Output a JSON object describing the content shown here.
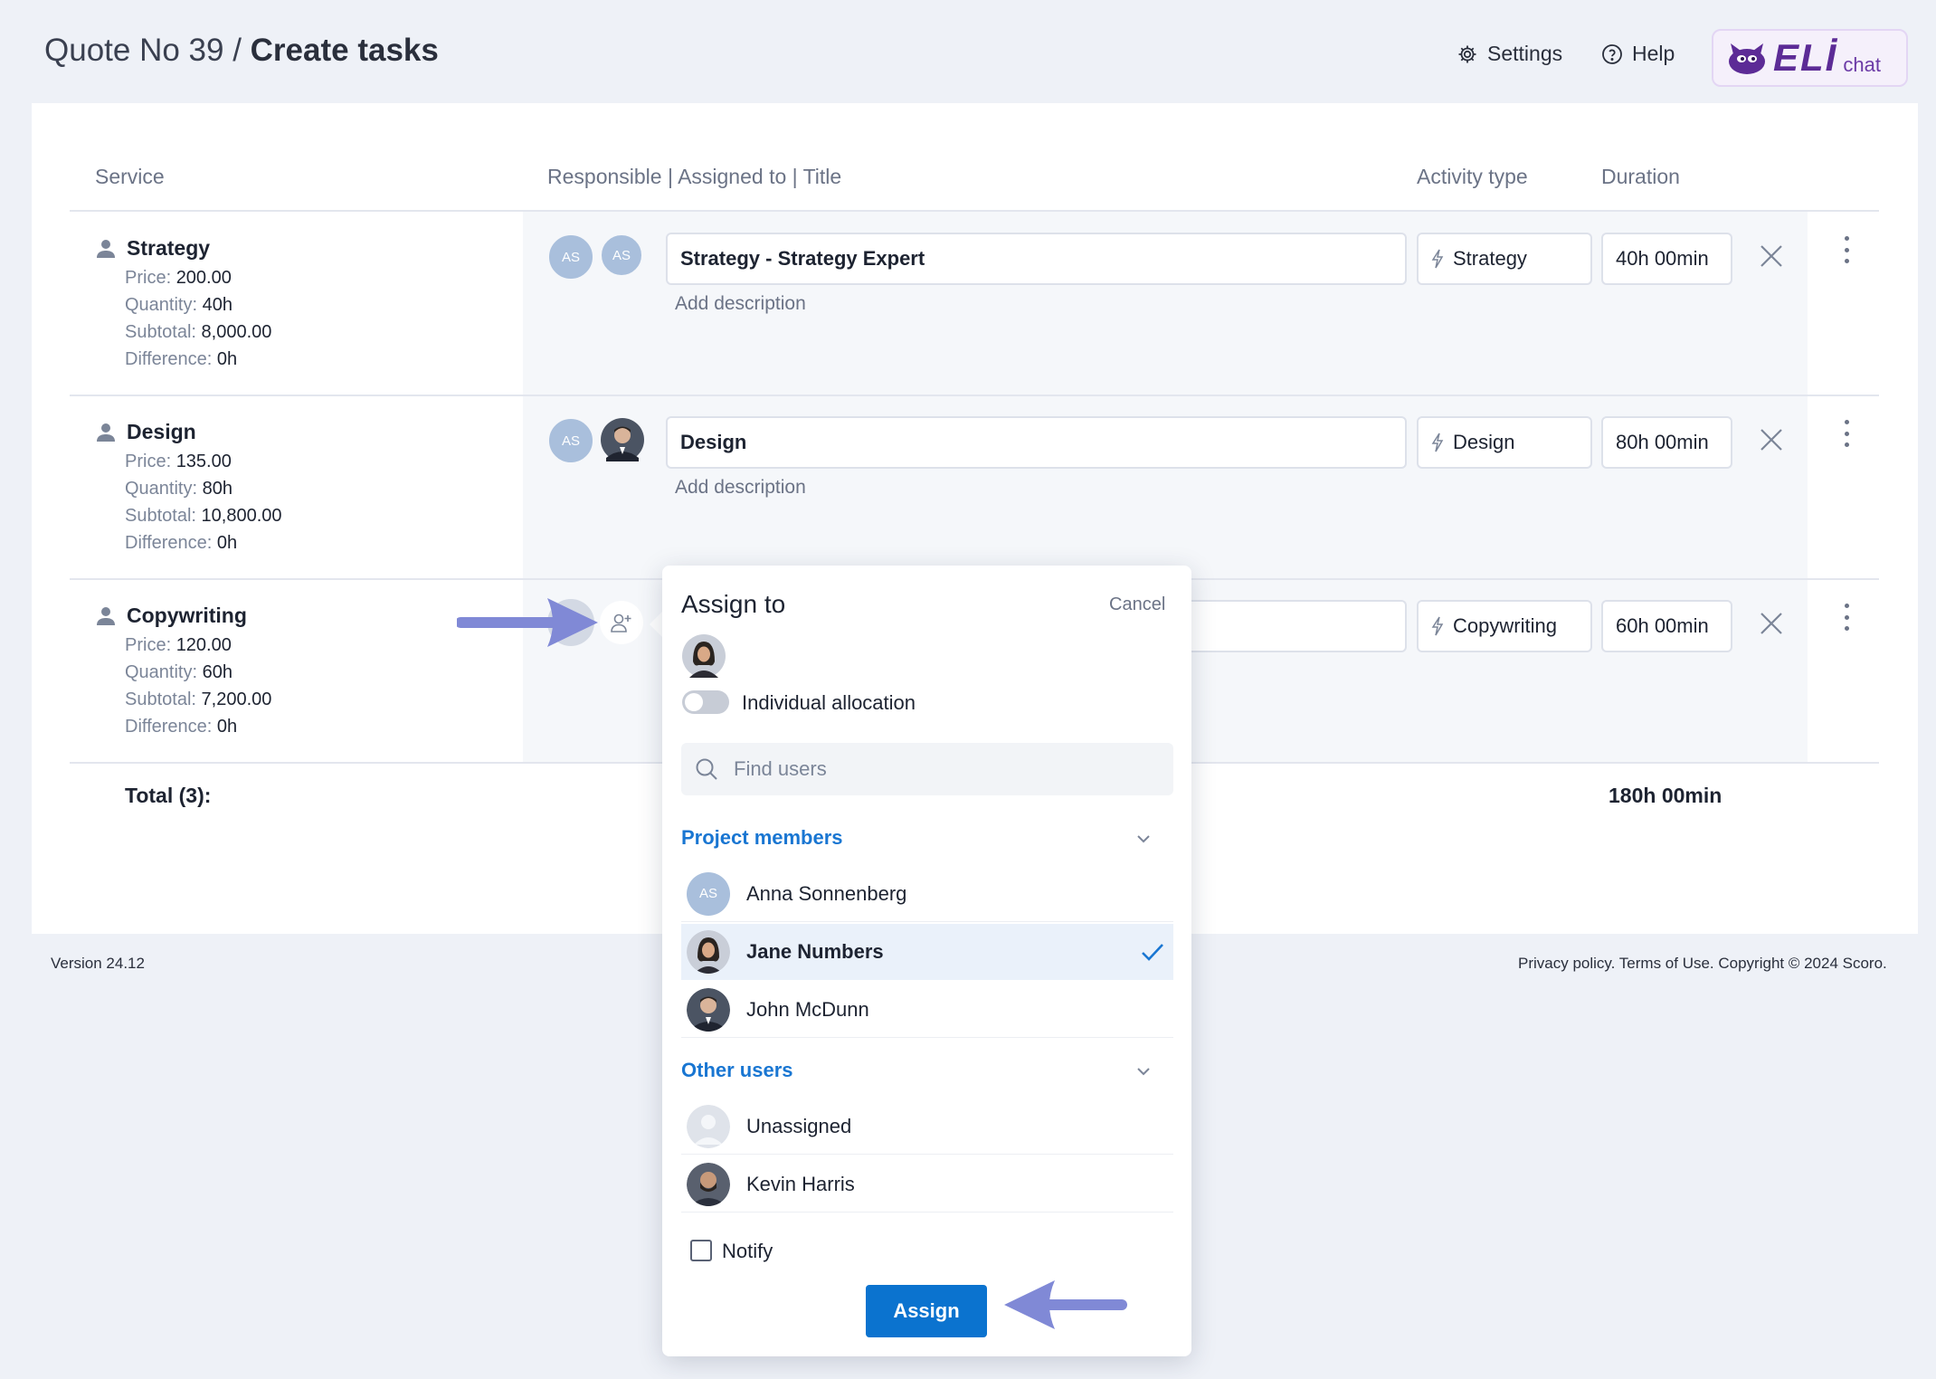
{
  "header": {
    "quote": "Quote No 39 /",
    "title": "Create tasks",
    "settings": "Settings",
    "help": "Help",
    "eli_logo": "ELİ",
    "eli_chat": "chat"
  },
  "columns": {
    "service": "Service",
    "responsible": "Responsible | Assigned to | Title",
    "activity": "Activity type",
    "duration": "Duration"
  },
  "labels": {
    "price": "Price:",
    "quantity": "Quantity:",
    "subtotal": "Subtotal:",
    "difference": "Difference:"
  },
  "rows": [
    {
      "name": "Strategy",
      "price": "200.00",
      "quantity": "40h",
      "subtotal": "8,000.00",
      "difference": "0h",
      "avatars": [
        "AS",
        "AS"
      ],
      "title": "Strategy - Strategy Expert",
      "description": "Add description",
      "activity": "Strategy",
      "duration": "40h 00min"
    },
    {
      "name": "Design",
      "price": "135.00",
      "quantity": "80h",
      "subtotal": "10,800.00",
      "difference": "0h",
      "avatars": [
        "AS"
      ],
      "title": "Design",
      "description": "Add description",
      "activity": "Design",
      "duration": "80h 00min"
    },
    {
      "name": "Copywriting",
      "price": "120.00",
      "quantity": "60h",
      "subtotal": "7,200.00",
      "difference": "0h",
      "activity": "Copywriting",
      "duration": "60h 00min"
    }
  ],
  "total": {
    "label": "Total (3):",
    "duration": "180h 00min"
  },
  "footer": {
    "version": "Version 24.12",
    "legal": "Privacy policy. Terms of Use. Copyright © 2024 Scoro."
  },
  "popup": {
    "title": "Assign to",
    "cancel": "Cancel",
    "toggle_label": "Individual allocation",
    "search_placeholder": "Find users",
    "project_members": {
      "label": "Project members",
      "users": [
        {
          "name": "Anna Sonnenberg",
          "initials": "AS"
        },
        {
          "name": "Jane Numbers"
        },
        {
          "name": "John McDunn"
        }
      ]
    },
    "other_users": {
      "label": "Other users",
      "users": [
        {
          "name": "Unassigned"
        },
        {
          "name": "Kevin Harris"
        }
      ]
    },
    "notify": "Notify",
    "assign": "Assign"
  },
  "colors": {
    "accent": "#1976d2",
    "button": "#0b73cf",
    "arrow": "#8089d6",
    "avatar": "#a9bfdc",
    "eli": "#5c2b96"
  }
}
